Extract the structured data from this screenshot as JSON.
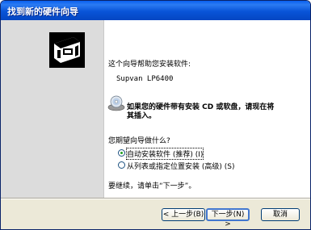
{
  "window": {
    "title": "找到新的硬件向导"
  },
  "intro": {
    "text": "这个向导帮助您安装软件:",
    "device_name": "Supvan LP6400"
  },
  "cd_notice": {
    "line1": "如果您的硬件带有安装 CD 或软盘，请现在将",
    "line2": "其插入。"
  },
  "question": "您期望向导做什么?",
  "options": [
    {
      "label": "自动安装软件 (推荐) (I)",
      "selected": true
    },
    {
      "label": "从列表或指定位置安装 (高级) (S)",
      "selected": false
    }
  ],
  "continue_text": "要继续，请单击“下一步”。",
  "buttons": {
    "back": "< 上一步(B)",
    "next": "下一步(N) >",
    "cancel": "取消"
  },
  "colors": {
    "titlebar": "#0a5ff0",
    "radio_dot": "#21a121"
  }
}
